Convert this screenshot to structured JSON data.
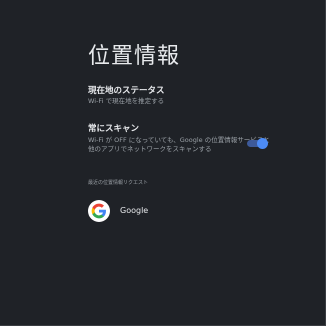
{
  "page": {
    "title": "位置情報"
  },
  "current_location_status": {
    "title": "現在地のステータス",
    "subtitle": "Wi-Fi で現在地を推定する"
  },
  "always_scan": {
    "title": "常にスキャン",
    "description": "Wi-Fi が OFF になっていても、Google の位置情報サービスと他のアプリでネットワークをスキャンする",
    "enabled": true
  },
  "recent_requests": {
    "header": "最近の位置情報リクエスト",
    "apps": [
      {
        "name": "Google",
        "icon": "google-g-logo"
      }
    ]
  },
  "colors": {
    "background": "#1f2227",
    "toggle_on": "#4c8bf5",
    "text_primary": "#e8eaed",
    "text_secondary": "#9aa0a6"
  }
}
